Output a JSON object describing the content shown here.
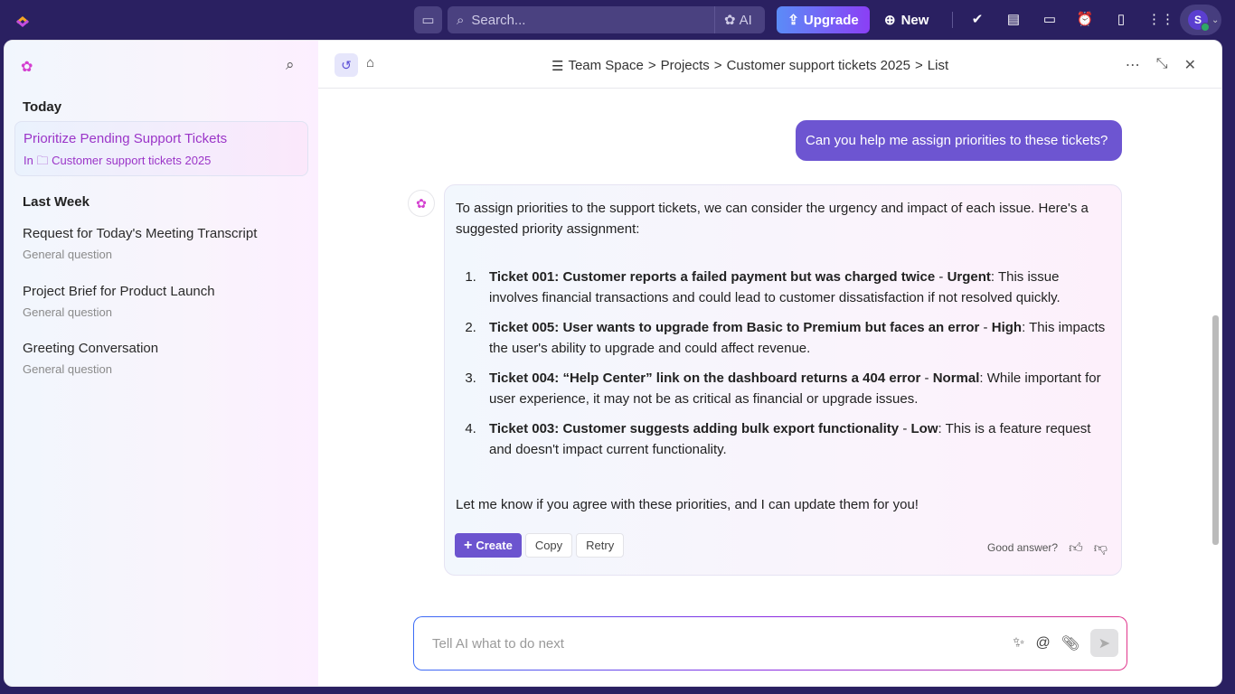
{
  "topbar": {
    "search_placeholder": "Search...",
    "ai_label": "AI",
    "upgrade_label": "Upgrade",
    "new_label": "New",
    "avatar_initial": "S"
  },
  "sidebar": {
    "today_label": "Today",
    "last_week_label": "Last Week",
    "active": {
      "title": "Prioritize Pending Support Tickets",
      "in_label": "In",
      "location": "Customer support tickets 2025"
    },
    "items": [
      {
        "title": "Request for Today's Meeting Transcript",
        "sub": "General question"
      },
      {
        "title": "Project Brief for Product Launch",
        "sub": "General question"
      },
      {
        "title": "Greeting Conversation",
        "sub": "General question"
      }
    ]
  },
  "header": {
    "breadcrumb": [
      "Team Space",
      "Projects",
      "Customer support tickets 2025",
      "List"
    ],
    "sep": ">"
  },
  "chat": {
    "user_message": "Can you help me assign priorities to these tickets?",
    "intro": "To assign priorities to the support tickets, we can consider the urgency and impact of each issue. Here's a suggested priority assignment:",
    "items": [
      {
        "ticket": "Ticket 001: Customer reports a failed payment but was charged twice",
        "dash": " - ",
        "priority": "Urgent",
        "text": ": This issue involves financial transactions and could lead to customer dissatisfaction if not resolved quickly."
      },
      {
        "ticket": "Ticket 005: User wants to upgrade from Basic to Premium but faces an error",
        "dash": " - ",
        "priority": "High",
        "text": ": This impacts the user's ability to upgrade and could affect revenue."
      },
      {
        "ticket": "Ticket 004: “Help Center” link on the dashboard returns a 404 error",
        "dash": " - ",
        "priority": "Normal",
        "text": ": While important for user experience, it may not be as critical as financial or upgrade issues."
      },
      {
        "ticket": "Ticket 003: Customer suggests adding bulk export functionality",
        "dash": " - ",
        "priority": "Low",
        "text": ": This is a feature request and doesn't impact current functionality."
      }
    ],
    "closing": "Let me know if you agree with these priorities, and I can update them for you!",
    "create_label": "Create",
    "copy_label": "Copy",
    "retry_label": "Retry",
    "feedback_label": "Good answer?"
  },
  "composer": {
    "placeholder": "Tell AI what to do next"
  }
}
